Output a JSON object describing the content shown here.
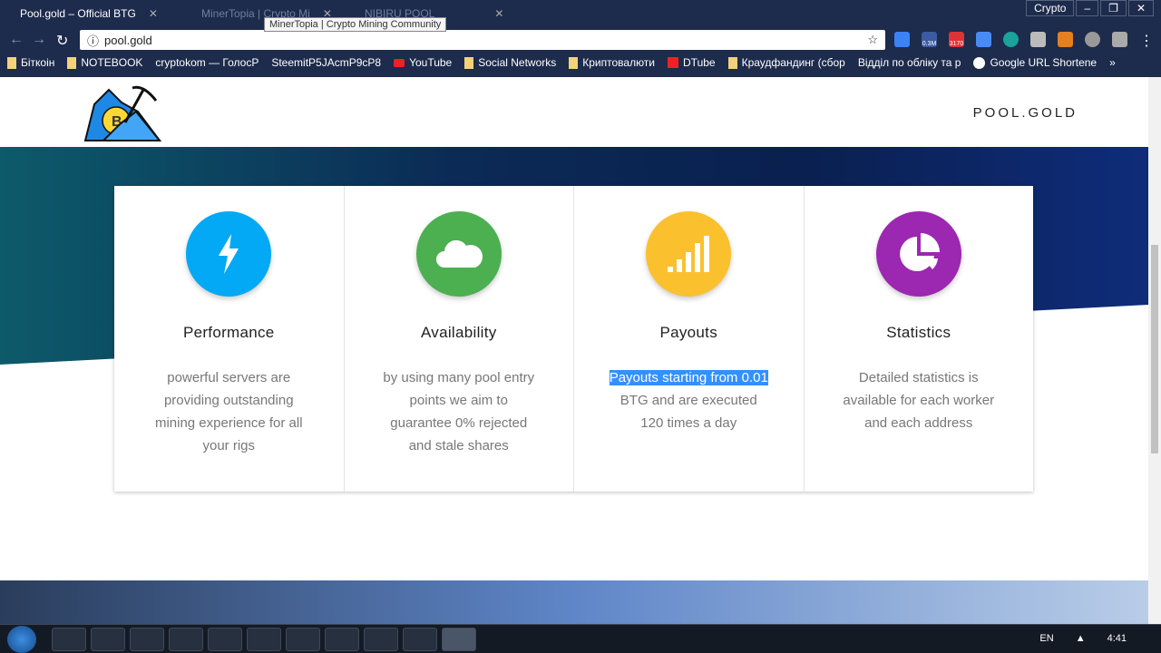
{
  "browser": {
    "tabs": [
      {
        "label": "Pool.gold – Official BTG",
        "active": true
      },
      {
        "label": "MinerTopia | Crypto Mi",
        "active": false
      },
      {
        "label": "NIBIRU POOL",
        "active": false
      }
    ],
    "tooltip": "MinerTopia | Crypto Mining Community",
    "profile": "Crypto",
    "url": "pool.gold",
    "extension_badges": [
      "0.3M",
      "3170"
    ],
    "bookmarks": [
      "Біткоін",
      "NOTEBOOK",
      "cryptokom — ГолосР",
      "SteemitP5JAcmP9cP8",
      "YouTube",
      "Social Networks",
      "Криптовалюти",
      "DTube",
      "Краудфандинг (сбор",
      "Відділ по обліку та р",
      "Google URL Shortene"
    ],
    "bookmarks_overflow": "»"
  },
  "site": {
    "brand": "POOL.GOLD",
    "features": [
      {
        "title": "Performance",
        "text": "powerful servers are providing outstanding mining experience for all your rigs",
        "color": "#03a9f4",
        "icon": "lightning-icon"
      },
      {
        "title": "Availability",
        "text": "by using many pool entry points we aim to guarantee 0% rejected and stale shares",
        "color": "#4caf50",
        "icon": "cloud-icon"
      },
      {
        "title": "Payouts",
        "text_selected": "Payouts starting from 0.01",
        "text": " BTG and are executed 120 times a day",
        "color": "#fbc02d",
        "icon": "signal-bars-icon"
      },
      {
        "title": "Statistics",
        "text": "Detailed statistics is available for each worker and each address",
        "color": "#9c27b0",
        "icon": "pie-chart-icon"
      }
    ]
  },
  "taskbar": {
    "language": "EN",
    "time": "4:41"
  }
}
